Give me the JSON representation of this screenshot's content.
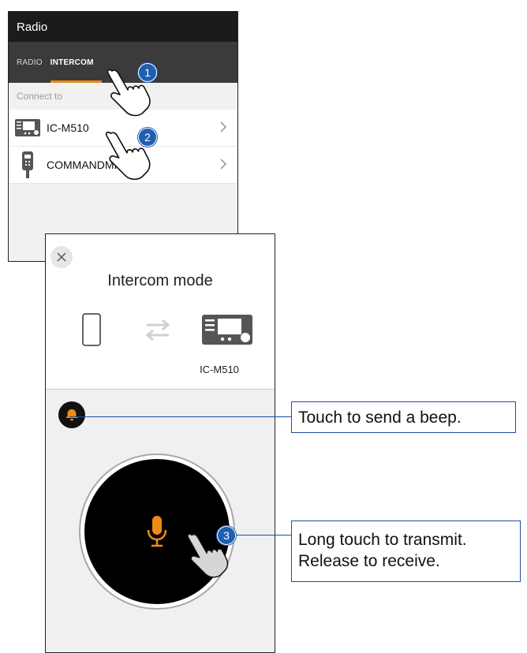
{
  "back_screen": {
    "title": "Radio",
    "tabs": [
      {
        "label": "RADIO",
        "active": false
      },
      {
        "label": "INTERCOM",
        "active": true
      }
    ],
    "section_label": "Connect to",
    "items": [
      {
        "label": "IC-M510",
        "icon": "radio-unit-icon"
      },
      {
        "label": "COMMANDMIC",
        "icon": "microphone-handset-icon"
      }
    ]
  },
  "front_screen": {
    "title": "Intercom mode",
    "device_name": "IC-M510",
    "icons": {
      "close": "close-icon",
      "phone": "smartphone-icon",
      "link": "swap-arrows-icon",
      "radio": "radio-unit-icon",
      "beep": "bell-icon",
      "ptt": "microphone-icon"
    }
  },
  "callouts": {
    "beep": "Touch to send a beep.",
    "ptt_line1": "Long touch to transmit.",
    "ptt_line2": "Release to receive."
  },
  "steps": [
    "1",
    "2",
    "3"
  ],
  "colors": {
    "appbar": "#1b1b1b",
    "tabbar": "#3b3b3b",
    "accent_orange": "#f08a12",
    "step_blue": "#1f5fb0",
    "callout_border": "#1b4fa0"
  }
}
